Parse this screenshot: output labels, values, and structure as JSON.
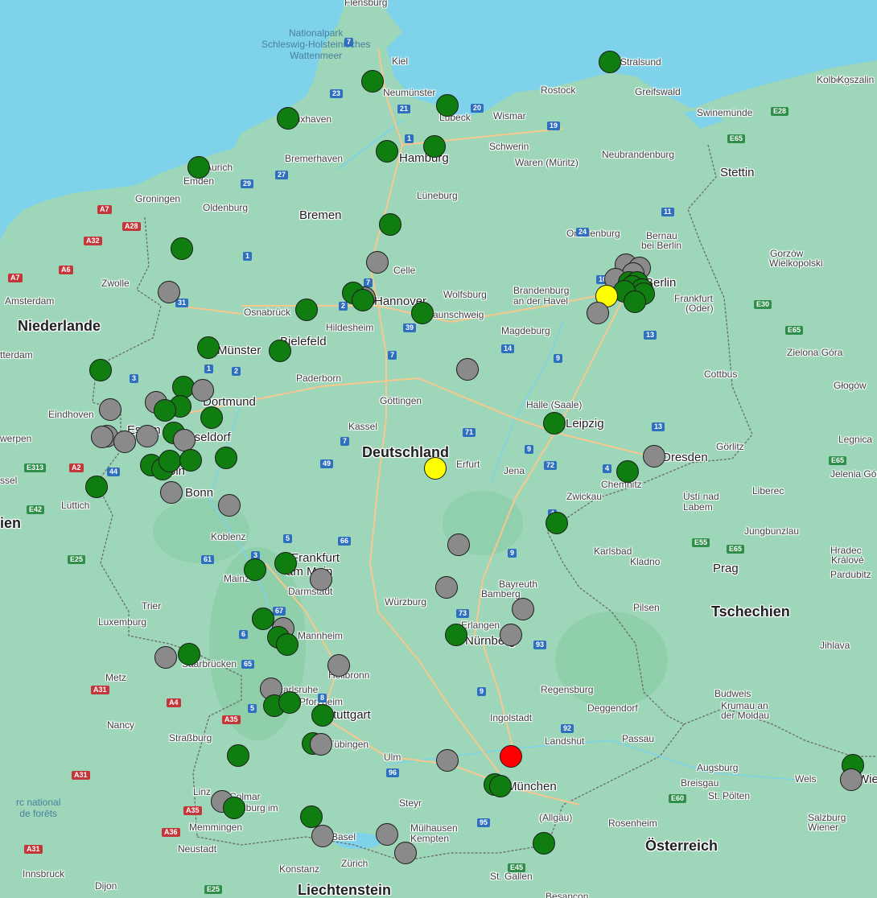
{
  "map": {
    "colors": {
      "land": "#9dd6b8",
      "sea": "#7ed3ea",
      "marker_green": "#0f7d0f",
      "marker_gray": "#8a8a8a",
      "marker_yellow": "#ffff00",
      "marker_red": "#ff0000"
    },
    "water_labels": [
      "Nationalpark\nSchleswig-Holsteinisches\nWattenmeer",
      "rc national\nde forêts"
    ],
    "country_labels": [
      "Niederlande",
      "Deutschland",
      "Tschechien",
      "Österreich",
      "Liechtenstein",
      "ien"
    ],
    "big_cities": [
      "Bremen",
      "Hannover",
      "Bielefeld",
      "Münster",
      "Dortmund",
      "Düsseldorf",
      "Köln",
      "Bonn",
      "Frankfurt",
      "am Main",
      "Stuttgart",
      "München",
      "Nürnberg",
      "Leipzig",
      "Dresden",
      "Berlin",
      "Hamburg",
      "Stettin",
      "Prag",
      "Wien",
      "Essen"
    ],
    "cities": [
      "Flensburg",
      "Kiel",
      "Neumünster",
      "Lübeck",
      "Wismar",
      "Rostock",
      "Stralsund",
      "Greifswald",
      "Kolberg",
      "Koszalin",
      "Swinemünde",
      "Cuxhaven",
      "Bremerhaven",
      "Schwerin",
      "Waren (Müritz)",
      "Neubrandenburg",
      "Aurich",
      "Emden",
      "Groningen",
      "Oldenburg",
      "Lüneburg",
      "Oranienburg",
      "Bernau",
      "bei Berlin",
      "Gorzów",
      "Wielkopolski",
      "Zwolle",
      "Amsterdam",
      "Celle",
      "Wolfsburg",
      "Braunschweig",
      "Brandenburg",
      "an der Havel",
      "Frankfurt",
      "(Oder)",
      "Osnabrück",
      "Hildesheim",
      "Magdeburg",
      "Zielona Góra",
      "tterdam",
      "Paderborn",
      "Cottbus",
      "Głogów",
      "Eindhoven",
      "Göttingen",
      "Halle (Saale)",
      "Kassel",
      "Görlitz",
      "Legnica",
      "werpen",
      "Erfurt",
      "Jena",
      "Chemnitz",
      "Jelenia Góra",
      "ssel",
      "Zwickau",
      "Liberec",
      "Ústí nad",
      "Labem",
      "Lüttich",
      "Koblenz",
      "Jungbunzlau",
      "Karlsbad",
      "Kladno",
      "Hradec",
      "Králové",
      "Pardubitz",
      "Mainz",
      "Darmstadt",
      "Bayreuth",
      "Bamberg",
      "Trier",
      "Würzburg",
      "Pilsen",
      "Luxemburg",
      "Erlangen",
      "Mannheim",
      "Jihlava",
      "Metz",
      "Saarbrücken",
      "Heilbronn",
      "Karlsruhe",
      "Regensburg",
      "Budweis",
      "Pforzheim",
      "Deggendorf",
      "Krumau an",
      "der Moldau",
      "Nancy",
      "Ingolstadt",
      "Straßburg",
      "Tübingen",
      "Landshut",
      "Passau",
      "Ulm",
      "Augsburg",
      "Linz",
      "Colmar",
      "Freiburg im",
      "Breisgau",
      "Wels",
      "St. Pölten",
      "Steyr",
      "Memmingen",
      "Mülhausen",
      "Kempten",
      "(Allgäu)",
      "Rosenheim",
      "Salzburg",
      "Wiener",
      "Neustadt",
      "Basel",
      "Konstanz",
      "Zürich",
      "St. Gallen",
      "Innsbruck",
      "Dijon",
      "Besançon",
      "Nationalpark"
    ],
    "road_shields": [
      "7",
      "23",
      "21",
      "1",
      "20",
      "19",
      "27",
      "29",
      "A7",
      "A28",
      "A32",
      "A6",
      "A7",
      "24",
      "11",
      "E28",
      "E65",
      "1",
      "7",
      "2",
      "39",
      "7",
      "10",
      "E30",
      "E65",
      "31",
      "1",
      "2",
      "3",
      "14",
      "13",
      "9",
      "7",
      "44",
      "4",
      "E313",
      "A2",
      "71",
      "9",
      "13",
      "E65",
      "61",
      "49",
      "4",
      "72",
      "E42",
      "E25",
      "3",
      "5",
      "66",
      "9",
      "E55",
      "E65",
      "67",
      "73",
      "93",
      "6",
      "65",
      "A31",
      "9",
      "5",
      "A4",
      "A35",
      "8",
      "92",
      "A31",
      "96",
      "95",
      "E60",
      "A35",
      "A36",
      "A31",
      "E45",
      "E25"
    ],
    "markers": [
      {
        "color": "green"
      },
      {
        "color": "green"
      },
      {
        "color": "green"
      },
      {
        "color": "green"
      },
      {
        "color": "green"
      },
      {
        "color": "green"
      },
      {
        "color": "green"
      },
      {
        "color": "green"
      },
      {
        "color": "green"
      },
      {
        "color": "gray"
      },
      {
        "color": "gray"
      },
      {
        "color": "gray"
      },
      {
        "color": "gray"
      },
      {
        "color": "gray"
      },
      {
        "color": "gray"
      },
      {
        "color": "green"
      },
      {
        "color": "green"
      },
      {
        "color": "green"
      },
      {
        "color": "green"
      },
      {
        "color": "green"
      },
      {
        "color": "green"
      },
      {
        "color": "yellow"
      },
      {
        "color": "gray"
      },
      {
        "color": "green"
      },
      {
        "color": "gray"
      },
      {
        "color": "green"
      },
      {
        "color": "green"
      },
      {
        "color": "green"
      },
      {
        "color": "green"
      },
      {
        "color": "green"
      },
      {
        "color": "green"
      },
      {
        "color": "green"
      },
      {
        "color": "gray"
      },
      {
        "color": "green"
      },
      {
        "color": "gray"
      },
      {
        "color": "gray"
      },
      {
        "color": "green"
      },
      {
        "color": "green"
      },
      {
        "color": "gray"
      },
      {
        "color": "green"
      },
      {
        "color": "gray"
      },
      {
        "color": "green"
      },
      {
        "color": "gray"
      },
      {
        "color": "gray"
      },
      {
        "color": "gray"
      },
      {
        "color": "gray"
      },
      {
        "color": "green"
      },
      {
        "color": "green"
      },
      {
        "color": "green"
      },
      {
        "color": "green"
      },
      {
        "color": "green"
      },
      {
        "color": "green"
      },
      {
        "color": "gray"
      },
      {
        "color": "gray"
      },
      {
        "color": "green"
      },
      {
        "color": "gray"
      },
      {
        "color": "green"
      },
      {
        "color": "yellow"
      },
      {
        "color": "green"
      },
      {
        "color": "gray"
      },
      {
        "color": "gray"
      },
      {
        "color": "green"
      },
      {
        "color": "green"
      },
      {
        "color": "gray"
      },
      {
        "color": "gray"
      },
      {
        "color": "green"
      },
      {
        "color": "gray"
      },
      {
        "color": "green"
      },
      {
        "color": "green"
      },
      {
        "color": "green"
      },
      {
        "color": "gray"
      },
      {
        "color": "gray"
      },
      {
        "color": "gray"
      },
      {
        "color": "green"
      },
      {
        "color": "gray"
      },
      {
        "color": "green"
      },
      {
        "color": "green"
      },
      {
        "color": "green"
      },
      {
        "color": "green"
      },
      {
        "color": "gray"
      },
      {
        "color": "red"
      },
      {
        "color": "gray"
      },
      {
        "color": "green"
      },
      {
        "color": "green"
      },
      {
        "color": "green"
      },
      {
        "color": "gray"
      },
      {
        "color": "green"
      },
      {
        "color": "green"
      },
      {
        "color": "gray"
      },
      {
        "color": "gray"
      },
      {
        "color": "gray"
      },
      {
        "color": "green"
      },
      {
        "color": "green"
      },
      {
        "color": "gray"
      },
      {
        "color": "green"
      },
      {
        "color": "green"
      },
      {
        "color": "gray"
      }
    ]
  }
}
